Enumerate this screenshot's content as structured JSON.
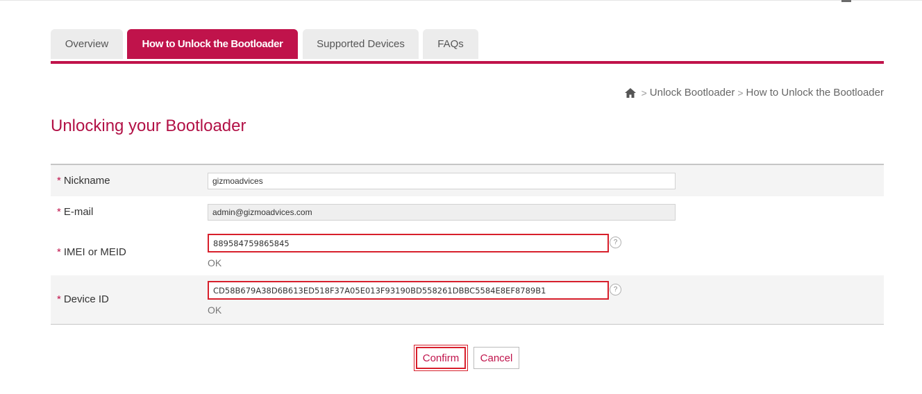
{
  "tabs": [
    {
      "label": "Overview",
      "active": false
    },
    {
      "label": "How to Unlock the Bootloader",
      "active": true
    },
    {
      "label": "Supported Devices",
      "active": false
    },
    {
      "label": "FAQs",
      "active": false
    }
  ],
  "breadcrumb": {
    "home_icon": "home-icon",
    "separator": ">",
    "items": [
      "Unlock Bootloader",
      "How to Unlock the Bootloader"
    ]
  },
  "page_title": "Unlocking your Bootloader",
  "form": {
    "required_mark": "*",
    "nickname": {
      "label": "Nickname",
      "value": "gizmoadvices"
    },
    "email": {
      "label": "E-mail",
      "value": "admin@gizmoadvices.com"
    },
    "imei": {
      "label": "IMEI or MEID",
      "value": "889584759865845",
      "help": "?",
      "status": "OK"
    },
    "device_id": {
      "label": "Device ID",
      "value": "CD58B679A38D6B613ED518F37A05E013F93190BD558261DBBC5584E8EF8789B1",
      "help": "?",
      "status": "OK"
    }
  },
  "buttons": {
    "confirm": "Confirm",
    "cancel": "Cancel"
  },
  "colors": {
    "accent": "#c0134b",
    "title": "#b21146",
    "highlight": "#d71f2b"
  }
}
